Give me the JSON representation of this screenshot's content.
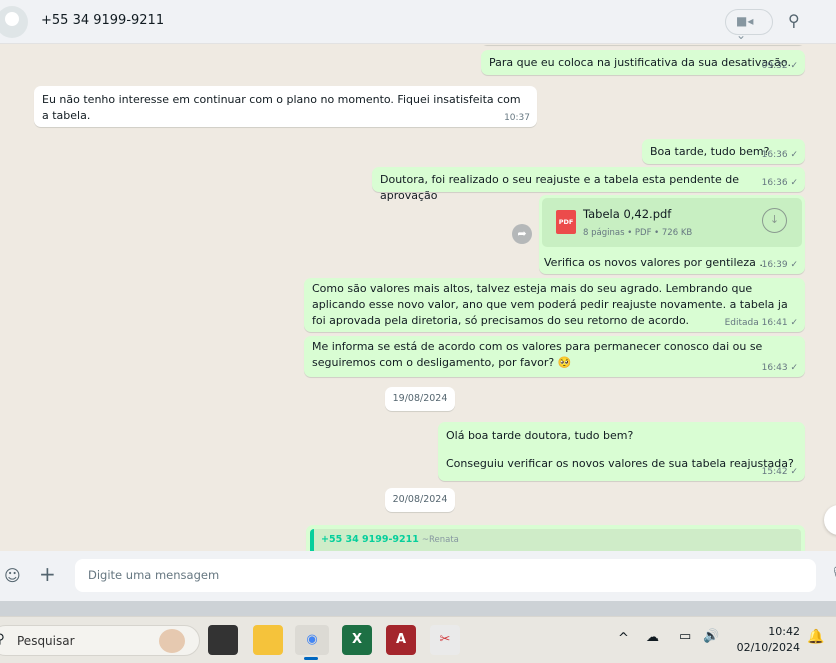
{
  "header": {
    "contact": "+55 34 9199-9211",
    "video_icon": "video-camera-icon",
    "search_icon": "search-icon"
  },
  "messages": [
    {
      "text": "Para que eu coloca na justificativa da sua desativação.",
      "time": "09:32"
    },
    {
      "text": "Eu não tenho interesse em continuar com o plano no momento. Fiquei insatisfeita com a tabela.",
      "time": "10:37"
    },
    {
      "text": "Boa tarde, tudo bem?",
      "time": "16:36"
    },
    {
      "text": "Doutora, foi realizado o seu reajuste e a tabela esta pendente de aprovação",
      "time": "16:36"
    },
    {
      "file_name": "Tabela 0,42.pdf",
      "file_meta": "8 páginas • PDF • 726 KB",
      "file_badge": "PDF",
      "text": "Verifica os novos valores por gentileza .",
      "time": "16:39"
    },
    {
      "text": "Como são valores mais altos, talvez esteja mais do seu agrado. Lembrando que aplicando esse novo valor, ano que vem poderá pedir reajuste novamente. a tabela ja foi aprovada pela diretoria, só precisamos do seu retorno de acordo.",
      "edited": "Editada",
      "time": "16:41"
    },
    {
      "text": "Me informa se está de acordo com os valores para permanecer conosco dai ou se seguiremos com o desligamento, por favor? 🥺",
      "time": "16:43"
    },
    {
      "date": "19/08/2024"
    },
    {
      "line1": "Olá boa tarde doutora, tudo bem?",
      "line2": "Conseguiu verificar os novos valores de sua tabela reajustada?",
      "time": "15:42"
    },
    {
      "date": "20/08/2024"
    },
    {
      "quote_author": "+55 34 9199-9211",
      "quote_name": "~Renata"
    }
  ],
  "composer": {
    "placeholder": "Digite uma mensagem"
  },
  "taskbar": {
    "search": "Pesquisar",
    "time": "10:42",
    "date": "02/10/2024"
  }
}
